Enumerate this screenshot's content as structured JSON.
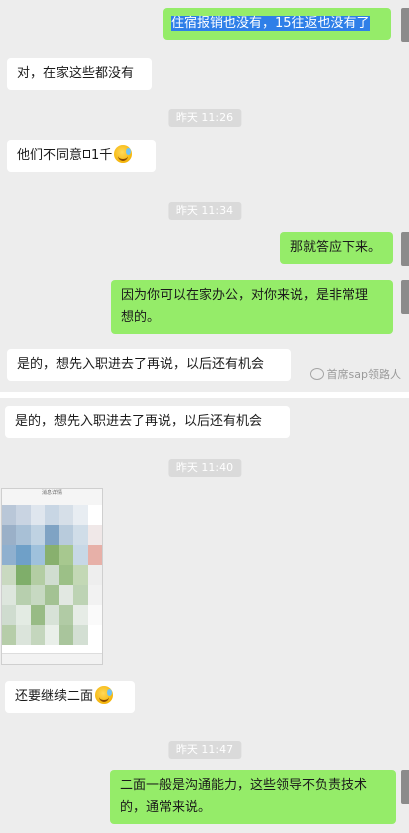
{
  "messages": [
    {
      "from": "right",
      "text": "住宿报销也没有，15往返也没有了"
    },
    {
      "from": "left",
      "text": "对，在家这些都没有"
    },
    {
      "timestamp": "昨天 11:26"
    },
    {
      "from": "left",
      "text_before": "他们不同意",
      "text_after": "1千",
      "emoji": "cry-laugh-icon"
    },
    {
      "timestamp": "昨天 11:34"
    },
    {
      "from": "right",
      "text": "那就答应下来。"
    },
    {
      "from": "right",
      "line1": "因为你可以在家办公，对你来说，是非常理",
      "line2": "想的。"
    },
    {
      "from": "left",
      "text": "是的，想先入职进去了再说，以后还有机会"
    }
  ],
  "watermark": "首席sap领路人",
  "second_panel": [
    {
      "from": "left",
      "text": "是的，想先入职进去了再说，以后还有机会"
    },
    {
      "timestamp": "昨天 11:40"
    },
    {
      "from": "left",
      "type": "image",
      "header": "消息详情"
    },
    {
      "from": "left",
      "text": "还要继续二面",
      "emoji": "cry-laugh-icon"
    },
    {
      "timestamp": "昨天 11:47"
    },
    {
      "from": "right",
      "line1": "二面一般是沟通能力，这些领导不负责技术",
      "line2": "的，通常来说。"
    }
  ]
}
